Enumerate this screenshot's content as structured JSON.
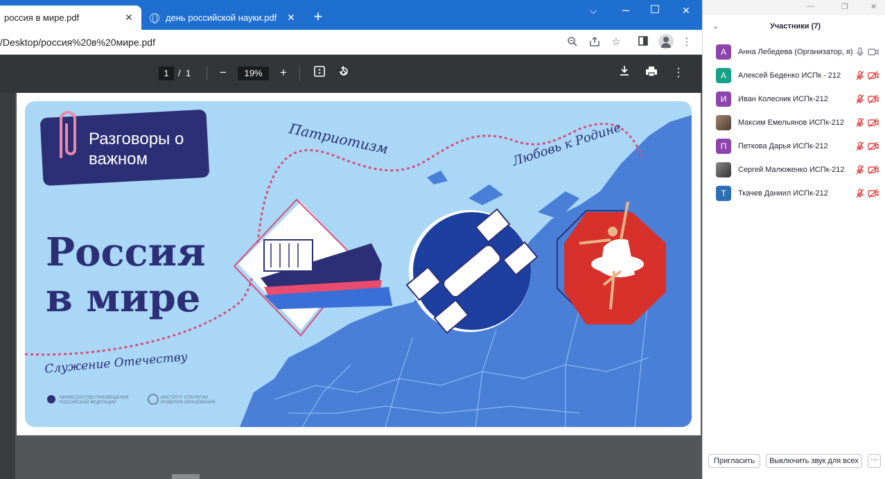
{
  "browser": {
    "tabs": [
      {
        "label": "россия в мире.pdf",
        "active": true
      },
      {
        "label": "день российской науки.pdf",
        "active": false
      }
    ],
    "url": "/Desktop/россия%20в%20мире.pdf",
    "window_controls": {
      "minimize": "⌵",
      "maximize": "☐",
      "close": "✕"
    }
  },
  "pdf_toolbar": {
    "current_page": "1",
    "separator": "/",
    "total_pages": "1",
    "zoom": "19%"
  },
  "slide": {
    "badge_text": "Разговоры о важном",
    "title": "Россия в мире",
    "motto_1": "Патриотизм",
    "motto_2": "Любовь к Родине",
    "motto_3": "Служение Отечеству",
    "logo_1": "Министерство просвещения Российской Федерации",
    "logo_2": "Институт стратегии развития образования",
    "colors": {
      "background": "#a9d7f5",
      "map": "#4a7fd8",
      "navy": "#2c2e76",
      "dashed": "#d94c7a",
      "red": "#d8302a"
    }
  },
  "participants": {
    "title": "Участники (7)",
    "list": [
      {
        "initial": "А",
        "name": "Анна Лебедева (Организатор, я)",
        "color": "#8e44ad",
        "muted": false
      },
      {
        "initial": "А",
        "name": "Алексей Беденко ИСПк - 212",
        "color": "#16a085",
        "muted": true
      },
      {
        "initial": "И",
        "name": "Иван Колесник ИСПк-212",
        "color": "#8e44ad",
        "muted": true
      },
      {
        "initial": "",
        "name": "Максим Емельянов ИСПк-212",
        "color": "photo",
        "muted": true
      },
      {
        "initial": "П",
        "name": "Петкова Дарья ИСПк-212",
        "color": "#8e44ad",
        "muted": true
      },
      {
        "initial": "",
        "name": "Сергей Малюженко ИСПк-212",
        "color": "photo2",
        "muted": true
      },
      {
        "initial": "Т",
        "name": "Ткачев Даниил ИСПк-212",
        "color": "#2c6fb5",
        "muted": true
      }
    ],
    "buttons": {
      "invite": "Пригласить",
      "mute_all": "Выключить звук для всех",
      "more": "···"
    }
  }
}
